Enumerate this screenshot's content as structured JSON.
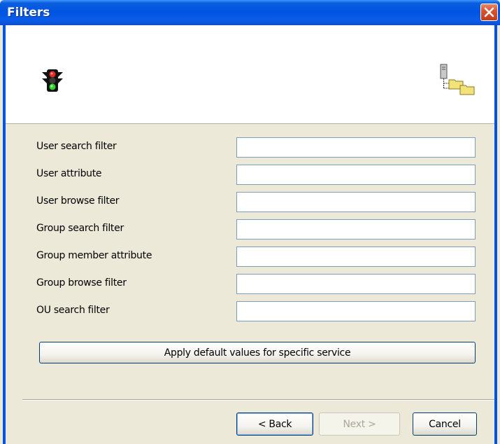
{
  "window": {
    "title": "Filters"
  },
  "header": {
    "left_icon": "traffic-light-icon",
    "right_icon": "ldap-tree-icon"
  },
  "fields": [
    {
      "label": "User search filter",
      "value": ""
    },
    {
      "label": "User attribute",
      "value": ""
    },
    {
      "label": "User browse filter",
      "value": ""
    },
    {
      "label": "Group search filter",
      "value": ""
    },
    {
      "label": "Group member attribute",
      "value": ""
    },
    {
      "label": "Group browse filter",
      "value": ""
    },
    {
      "label": "OU search filter",
      "value": ""
    }
  ],
  "apply_button": {
    "label": "Apply default values for specific service"
  },
  "buttons": {
    "back": "< Back",
    "next": "Next >",
    "cancel": "Cancel"
  },
  "colors": {
    "titlebar": "#0054e3",
    "dialog_bg": "#ece9d8",
    "input_border": "#7f9db9"
  }
}
